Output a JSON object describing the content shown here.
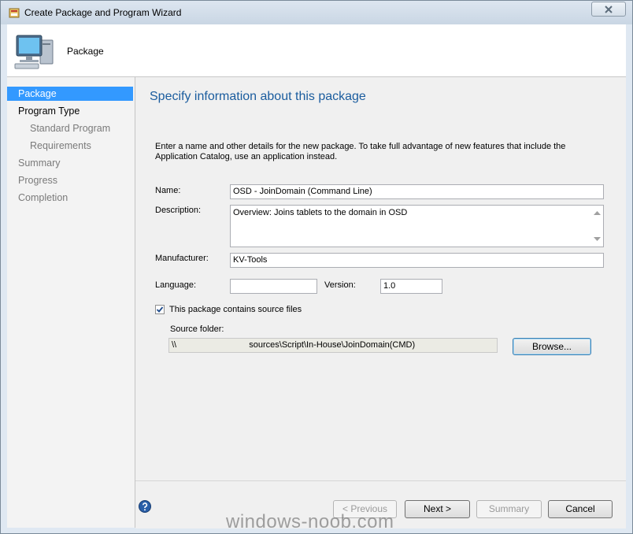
{
  "window": {
    "title": "Create Package and Program Wizard"
  },
  "header": {
    "title": "Package"
  },
  "nav": {
    "items": [
      {
        "label": "Package"
      },
      {
        "label": "Program Type"
      },
      {
        "label": "Standard Program"
      },
      {
        "label": "Requirements"
      },
      {
        "label": "Summary"
      },
      {
        "label": "Progress"
      },
      {
        "label": "Completion"
      }
    ]
  },
  "content": {
    "title": "Specify information about this package",
    "intro": "Enter a name and other details for the new package. To take full advantage of new features that include the Application Catalog, use an application instead.",
    "name_label": "Name:",
    "name_value": "OSD - JoinDomain (Command Line)",
    "description_label": "Description:",
    "description_value": "Overview: Joins tablets to the domain in OSD",
    "manufacturer_label": "Manufacturer:",
    "manufacturer_value": "KV-Tools",
    "language_label": "Language:",
    "language_value": "",
    "version_label": "Version:",
    "version_value": "1.0",
    "source_checkbox_label": "This package contains source files",
    "source_checkbox_checked": true,
    "source_folder_label": "Source folder:",
    "source_folder_prefix": "\\\\",
    "source_folder_suffix": "sources\\Script\\In-House\\JoinDomain(CMD)",
    "browse_label": "Browse..."
  },
  "footer": {
    "previous_label": "< Previous",
    "next_label": "Next >",
    "summary_label": "Summary",
    "cancel_label": "Cancel"
  },
  "watermark": "windows-noob.com",
  "colors": {
    "accent": "#3399ff",
    "title_blue": "#1a5c9e"
  }
}
